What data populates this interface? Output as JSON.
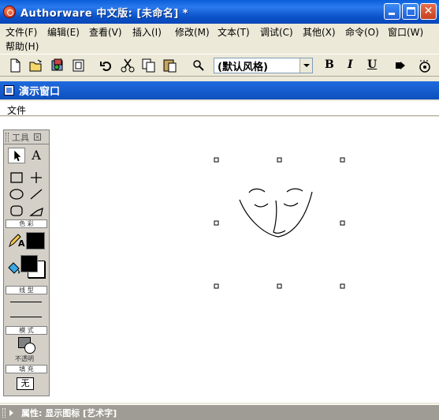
{
  "window": {
    "title": "Authorware 中文版: [未命名] *"
  },
  "menu": {
    "items": [
      {
        "label": "文件(F)"
      },
      {
        "label": "编辑(E)"
      },
      {
        "label": "查看(V)"
      },
      {
        "label": "插入(I)"
      },
      {
        "label": "修改(M)"
      },
      {
        "label": "文本(T)"
      },
      {
        "label": "调试(C)"
      },
      {
        "label": "其他(X)"
      },
      {
        "label": "命令(O)"
      },
      {
        "label": "窗口(W)"
      },
      {
        "label": "帮助(H)"
      }
    ]
  },
  "toolbar": {
    "style_value": "(默认风格)",
    "bold": "B",
    "italic": "I",
    "underline": "U"
  },
  "presentation": {
    "title": "演示窗口",
    "menu_file": "文件"
  },
  "palette": {
    "title": "工具",
    "section_color": "色 彩",
    "section_line": "线 型",
    "section_mode": "模 式",
    "mode_value": "不透明",
    "section_fill": "填 充",
    "fill_value": "无",
    "text_tool": "A",
    "text_color_label": "A"
  },
  "status": {
    "text": "属性: 显示图标 [艺术字]"
  },
  "colors": {
    "title_bar": "#0a5fd8",
    "pres_title": "#1f6bde",
    "status_bar": "#9e9c94"
  }
}
